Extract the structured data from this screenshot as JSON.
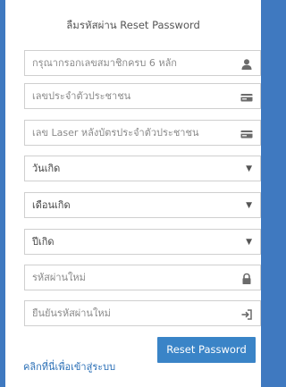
{
  "form": {
    "title": "ลืมรหัสผ่าน Reset Password",
    "fields": [
      {
        "placeholder": "กรุณากรอกเลขสมาชิกครบ 6 หลัก",
        "icon": "user-icon"
      },
      {
        "placeholder": "เลขประจำตัวประชาชน",
        "icon": "id-card-icon"
      },
      {
        "placeholder": "เลข Laser หลังบัตรประจำตัวประชาชน",
        "icon": "id-card-icon"
      },
      {
        "placeholder": "วันเกิด",
        "icon": "chevron-down-icon"
      },
      {
        "placeholder": "เดือนเกิด",
        "icon": "chevron-down-icon"
      },
      {
        "placeholder": "ปีเกิด",
        "icon": "chevron-down-icon"
      },
      {
        "placeholder": "รหัสผ่านใหม่",
        "icon": "lock-icon"
      },
      {
        "placeholder": "ยืนยันรหัสผ่านใหม่",
        "icon": "sign-in-icon"
      }
    ],
    "submit_label": "Reset Password",
    "login_link": "คลิกที่นี่เพื่อเข้าสู่ระบบ"
  },
  "colors": {
    "background": "#3f79c0",
    "button": "#3a84c7",
    "link": "#2a6fb6"
  }
}
